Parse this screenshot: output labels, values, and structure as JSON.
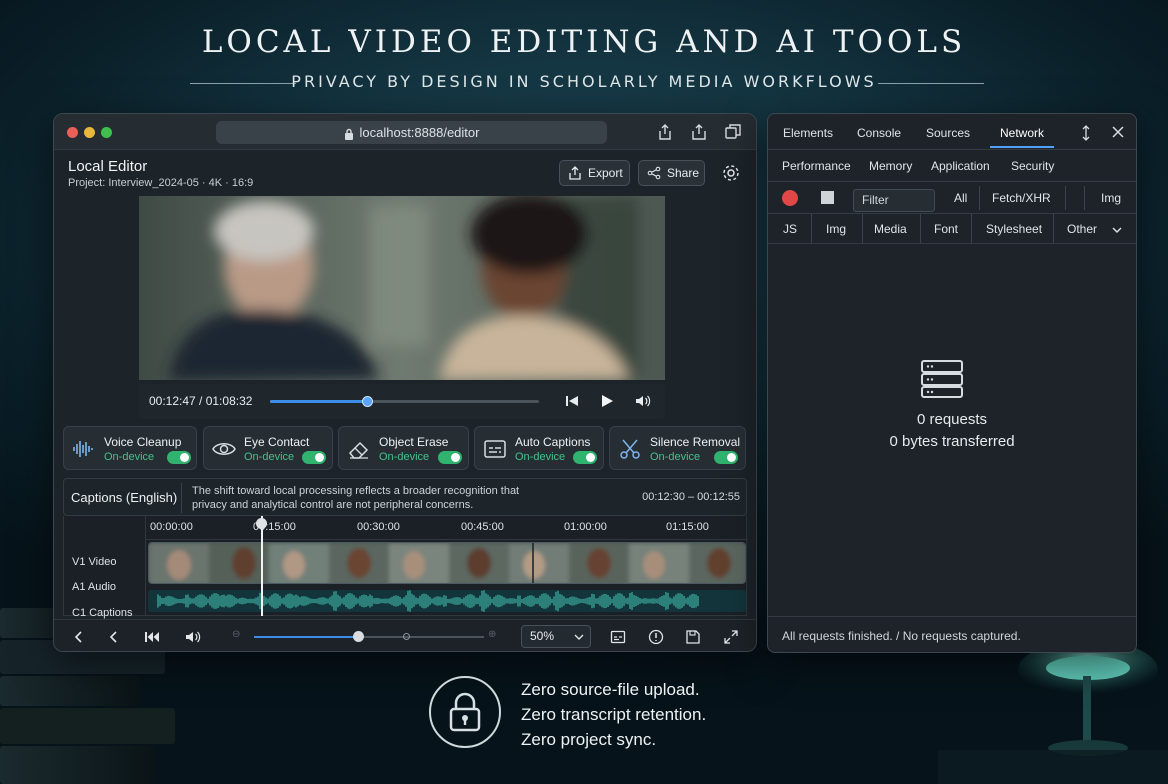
{
  "headline": "LOCAL VIDEO EDITING AND AI TOOLS",
  "subheadline": "PRIVACY BY DESIGN IN SCHOLARLY MEDIA WORKFLOWS",
  "editor": {
    "url": "localhost:8888/editor",
    "title": "Local Editor",
    "project": "Project: Interview_2024-05 · 4K · 16:9",
    "export_label": "Export",
    "share_label": "Share",
    "player": {
      "time": "00:12:47 / 01:08:32",
      "progress": 0.36
    },
    "tools": [
      {
        "name": "Voice Cleanup",
        "status": "On-device",
        "icon": "waveform-icon",
        "enabled": true
      },
      {
        "name": "Eye Contact",
        "status": "On-device",
        "icon": "eye-icon",
        "enabled": true
      },
      {
        "name": "Object Erase",
        "status": "On-device",
        "icon": "eraser-icon",
        "enabled": true
      },
      {
        "name": "Auto Captions",
        "status": "On-device",
        "icon": "captions-icon",
        "enabled": true
      },
      {
        "name": "Silence Removal",
        "status": "On-device",
        "icon": "scissors-icon",
        "enabled": true
      }
    ],
    "captions": {
      "label": "Captions (English)",
      "text": "The shift toward local processing reflects a broader recognition that privacy and analytical control are not peripheral concerns.",
      "range": "00:12:30 – 00:12:55"
    },
    "timeline": {
      "ticks": [
        "00:00:00",
        "00:15:00",
        "00:30:00",
        "00:45:00",
        "01:00:00",
        "01:15:00"
      ],
      "tracks": [
        "V1 Video",
        "A1 Audio",
        "C1 Captions"
      ]
    },
    "zoom": {
      "value": "50%",
      "level": 0.45
    }
  },
  "devtools": {
    "tabs": [
      "Elements",
      "Console",
      "Sources",
      "Network"
    ],
    "active_tab": "Network",
    "subtabs": [
      "Performance",
      "Memory",
      "Application",
      "Security"
    ],
    "filter_placeholder": "Filter",
    "filters_row1": [
      "All",
      "Fetch/XHR",
      "Img"
    ],
    "filters_row2": [
      "JS",
      "Img",
      "Media",
      "Font",
      "Stylesheet",
      "Other"
    ],
    "requests": "0 requests",
    "bytes": "0 bytes transferred",
    "status": "All requests finished. / No requests captured."
  },
  "claims": [
    "Zero source-file upload.",
    "Zero transcript retention.",
    "Zero project sync."
  ],
  "colors": {
    "accent": "#3d8ee8",
    "toggle_on": "#2fb36f",
    "record": "#e04848",
    "waveform": "#3fb3a3"
  }
}
